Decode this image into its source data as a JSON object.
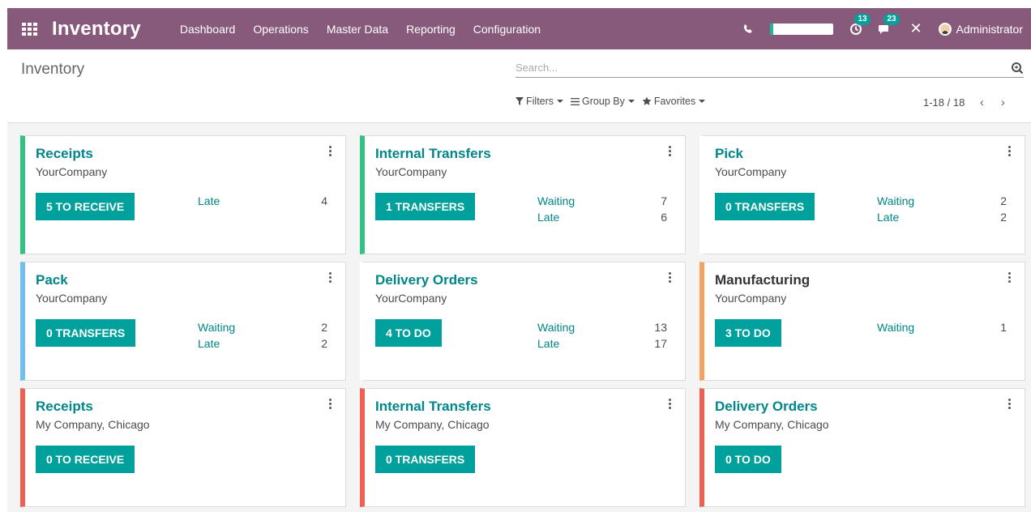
{
  "navbar": {
    "app_name": "Inventory",
    "menu": [
      "Dashboard",
      "Operations",
      "Master Data",
      "Reporting",
      "Configuration"
    ],
    "progress_fraction": 0.05,
    "activity_badge": "13",
    "messages_badge": "23",
    "user_name": "Administrator"
  },
  "control_panel": {
    "title": "Inventory",
    "search_placeholder": "Search...",
    "filters_label": "Filters",
    "groupby_label": "Group By",
    "favorites_label": "Favorites",
    "pager_label": "1-18 / 18"
  },
  "colors": {
    "brand": "#875a7b",
    "accent": "#00a09d",
    "title": "#00868a",
    "green": "#30c381",
    "blue": "#6cc1ed",
    "orange": "#f4a460",
    "red": "#f06050"
  },
  "cards": [
    {
      "title": "Receipts",
      "company": "YourCompany",
      "button": "5 TO RECEIVE",
      "color": "#30c381",
      "title_dark": false,
      "stats": [
        {
          "label": "Late",
          "count": "4"
        }
      ]
    },
    {
      "title": "Internal Transfers",
      "company": "YourCompany",
      "button": "1 TRANSFERS",
      "color": "#30c381",
      "title_dark": false,
      "stats": [
        {
          "label": "Waiting",
          "count": "7"
        },
        {
          "label": "Late",
          "count": "6"
        }
      ]
    },
    {
      "title": "Pick",
      "company": "YourCompany",
      "button": "0 TRANSFERS",
      "color": "#ffffff",
      "title_dark": false,
      "stats": [
        {
          "label": "Waiting",
          "count": "2"
        },
        {
          "label": "Late",
          "count": "2"
        }
      ]
    },
    {
      "title": "Pack",
      "company": "YourCompany",
      "button": "0 TRANSFERS",
      "color": "#6cc1ed",
      "title_dark": false,
      "stats": [
        {
          "label": "Waiting",
          "count": "2"
        },
        {
          "label": "Late",
          "count": "2"
        }
      ]
    },
    {
      "title": "Delivery Orders",
      "company": "YourCompany",
      "button": "4 TO DO",
      "color": "#ffffff",
      "title_dark": false,
      "stats": [
        {
          "label": "Waiting",
          "count": "13"
        },
        {
          "label": "Late",
          "count": "17"
        }
      ]
    },
    {
      "title": "Manufacturing",
      "company": "YourCompany",
      "button": "3 TO DO",
      "color": "#f4a460",
      "title_dark": true,
      "stats": [
        {
          "label": "Waiting",
          "count": "1"
        }
      ]
    },
    {
      "title": "Receipts",
      "company": "My Company, Chicago",
      "button": "0 TO RECEIVE",
      "color": "#f06050",
      "title_dark": false,
      "stats": []
    },
    {
      "title": "Internal Transfers",
      "company": "My Company, Chicago",
      "button": "0 TRANSFERS",
      "color": "#f06050",
      "title_dark": false,
      "stats": []
    },
    {
      "title": "Delivery Orders",
      "company": "My Company, Chicago",
      "button": "0 TO DO",
      "color": "#f06050",
      "title_dark": false,
      "stats": []
    }
  ]
}
